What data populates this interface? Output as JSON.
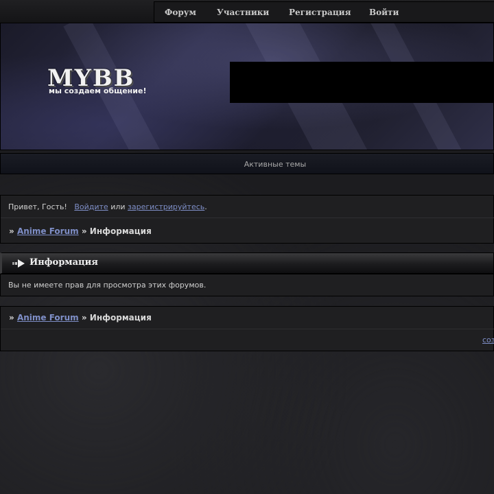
{
  "nav": {
    "items": [
      {
        "label": "Форум"
      },
      {
        "label": "Участники"
      },
      {
        "label": "Регистрация"
      },
      {
        "label": "Войти"
      }
    ]
  },
  "header": {
    "logo_main": "MYBB",
    "logo_sub": "мы создаем общение!"
  },
  "active_topics": "Активные темы",
  "welcome": {
    "greeting": "Привет, Гость!",
    "login": "Войдите",
    "or": "или",
    "register": "зарегистрируйтесь",
    "end": "."
  },
  "breadcrumb": {
    "sep1": "»",
    "forum": "Anime Forum",
    "sep2": "»",
    "current": "Информация"
  },
  "section": {
    "title": "Информация",
    "message": "Вы не имеете прав для просмотра этих форумов."
  },
  "footer": {
    "link": "соз"
  },
  "colors": {
    "link": "#7f8fc8",
    "background": "#1c1c1f",
    "panel": "#1f1f21"
  }
}
